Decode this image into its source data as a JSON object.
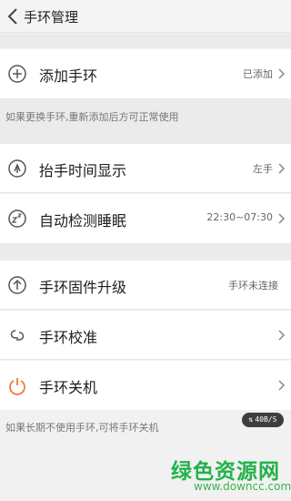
{
  "header": {
    "title": "手环管理"
  },
  "sections": {
    "bind": {
      "add": {
        "label": "添加手环",
        "value": "已添加"
      },
      "note": "如果更换手环,重新添加后方可正常使用"
    },
    "features": {
      "raise_wrist": {
        "label": "抬手时间显示",
        "value": "左手"
      },
      "sleep": {
        "label": "自动检测睡眠",
        "value": "22:30~07:30"
      }
    },
    "device": {
      "firmware": {
        "label": "手环固件升级",
        "value": "手环未连接"
      },
      "calibrate": {
        "label": "手环校准"
      },
      "power_off": {
        "label": "手环关机"
      },
      "note": "如果长期不使用手环,可将手环关机"
    }
  },
  "overlay": {
    "net_speed": "40B/S"
  },
  "watermark": {
    "main": "绿色资源网",
    "sub": "www.downcc.com"
  },
  "colors": {
    "accent_power": "#f07a3a",
    "watermark": "#23b24b"
  }
}
